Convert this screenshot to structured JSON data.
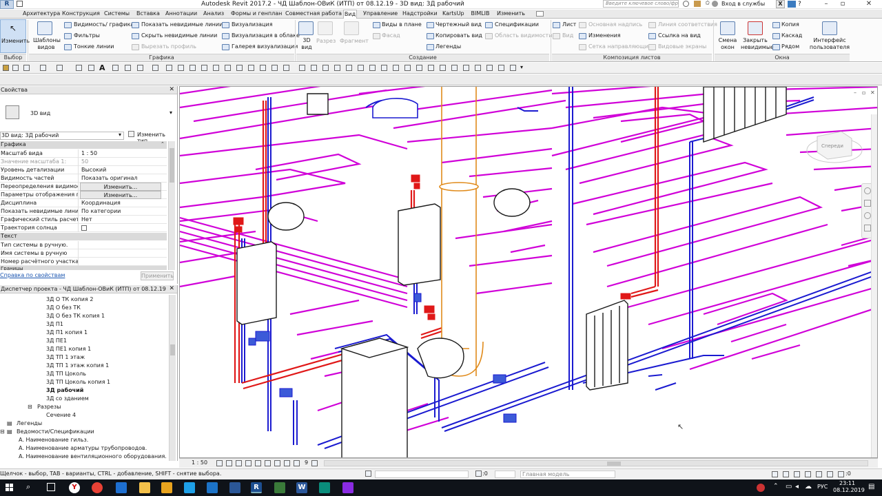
{
  "app": {
    "title": "Autodesk Revit 2017.2 -      ЧД Шаблон-ОВиК (ИТП) от 08.12.19 - 3D вид: 3Д рабочий",
    "logo": "R",
    "search_placeholder": "Введите ключевое слово/фразу",
    "login": "Вход в службы",
    "help": "?"
  },
  "tabs": [
    "Архитектура",
    "Конструкция",
    "Системы",
    "Вставка",
    "Аннотации",
    "Анализ",
    "Формы и генплан",
    "Совместная работа",
    "Вид",
    "Управление",
    "Надстройки",
    "KartsUp",
    "BIMLIB",
    "Изменить"
  ],
  "active_tab": "Вид",
  "ribbon": {
    "modify": "Изменить",
    "view_templates": "Шаблоны видов",
    "visibility_graphics": "Видимость/ графика",
    "filters": "Фильтры",
    "thin_lines": "Тонкие линии",
    "show_hidden": "Показать невидимые линии",
    "hide_hidden": "Скрыть невидимые линии",
    "cut_profile": "Вырезать профиль",
    "render": "Визуализация",
    "render_cloud": "Визуализация в облаке",
    "render_gallery": "Галерея визуализации",
    "view3d": "3D вид",
    "section": "Разрез",
    "callout": "Фрагмент",
    "plan_views": "Виды в плане",
    "elevation": "Фасад",
    "drafting": "Чертежный вид",
    "duplicate": "Копировать вид",
    "legends": "Легенды",
    "schedules": "Спецификации",
    "scope_box": "Область видимости",
    "sheet": "Лист",
    "view": "Вид",
    "title_block": "Основная надпись",
    "revisions": "Изменения",
    "guide_grid": "Сетка направляющих",
    "matchline": "Линия соответствия",
    "view_reference": "Ссылка на вид",
    "viewports": "Видовые экраны",
    "switch_windows": "Смена окон",
    "close_hidden": "Закрыть невидимые",
    "replicate": "Копия",
    "cascade": "Каскад",
    "tile": "Рядом",
    "user_interface": "Интерфейс пользователя",
    "panels": {
      "select": "Выбор",
      "graphics": "Графика",
      "create": "Создание",
      "sheet_composition": "Композиция листов",
      "windows": "Окна"
    }
  },
  "properties": {
    "header": "Свойства",
    "type_name": "3D вид",
    "selector": "3D вид: 3Д рабочий",
    "edit_type": "Изменить тип",
    "section_graphics": "Графика",
    "rows": [
      {
        "k": "Масштаб вида",
        "v": "1 : 50"
      },
      {
        "k": "Значение масштаба    1:",
        "v": "50"
      },
      {
        "k": "Уровень детализации",
        "v": "Высокий"
      },
      {
        "k": "Видимость частей",
        "v": "Показать оригинал"
      },
      {
        "k": "Переопределения видимост...",
        "v": "Изменить..."
      },
      {
        "k": "Параметры отображения гр...",
        "v": "Изменить..."
      },
      {
        "k": "Дисциплина",
        "v": "Координация"
      },
      {
        "k": "Показать невидимые линии",
        "v": "По категории"
      },
      {
        "k": "Графический стиль расчета ...",
        "v": "Нет"
      },
      {
        "k": "Траектория солнца",
        "v": ""
      }
    ],
    "section_text": "Текст",
    "text_rows": [
      {
        "k": "Тип системы в ручную.",
        "v": ""
      },
      {
        "k": "Имя системы в ручную",
        "v": ""
      },
      {
        "k": "Номер расчётного участка",
        "v": ""
      }
    ],
    "section_bounds": "Границы",
    "help_link": "Справка по свойствам",
    "apply": "Применить"
  },
  "browser": {
    "header": "Диспетчер проекта - ЧД Шаблон-ОВиК (ИТП) от 08.12.19",
    "views": [
      "3Д О ТК копия 2",
      "3Д О без ТК",
      "3Д О без ТК копия 1",
      "3Д П1",
      "3Д П1 копия 1",
      "3Д ПЕ1",
      "3Д ПЕ1 копия 1",
      "3Д ТП 1 этаж",
      "3Д ТП 1 этаж копия 1",
      "3Д ТП Цоколь",
      "3Д ТП Цоколь копия 1",
      "3Д рабочий",
      "3Д со зданием"
    ],
    "active_view": "3Д рабочий",
    "sections_group": "Разрезы",
    "section_item": "Сечение 4",
    "legends": "Легенды",
    "schedules": "Ведомости/Спецификации",
    "schedule_items": [
      "А. Наименование гильз.",
      "А. Наименование арматуры трубопроводов.",
      "А. Наименование вентиляционного оборудования."
    ]
  },
  "viewport": {
    "viewcube_label": "Спереди"
  },
  "viewctrl": {
    "scale": "1 : 50",
    "count": "9"
  },
  "status": {
    "text": "Щелчок - выбор, TAB - варианты, CTRL - добавление, SHIFT - снятие выбора.",
    "zero": ":0",
    "model": "Главная модель",
    "filter_count": ":0"
  },
  "taskbar": {
    "lang": "РУС",
    "time": "23:11",
    "date": "08.12.2019"
  },
  "colors": {
    "pink": "#d000d8",
    "red": "#e01818",
    "blue": "#1a1ad0",
    "orange": "#e08a1a",
    "dark": "#1a1a1a"
  }
}
